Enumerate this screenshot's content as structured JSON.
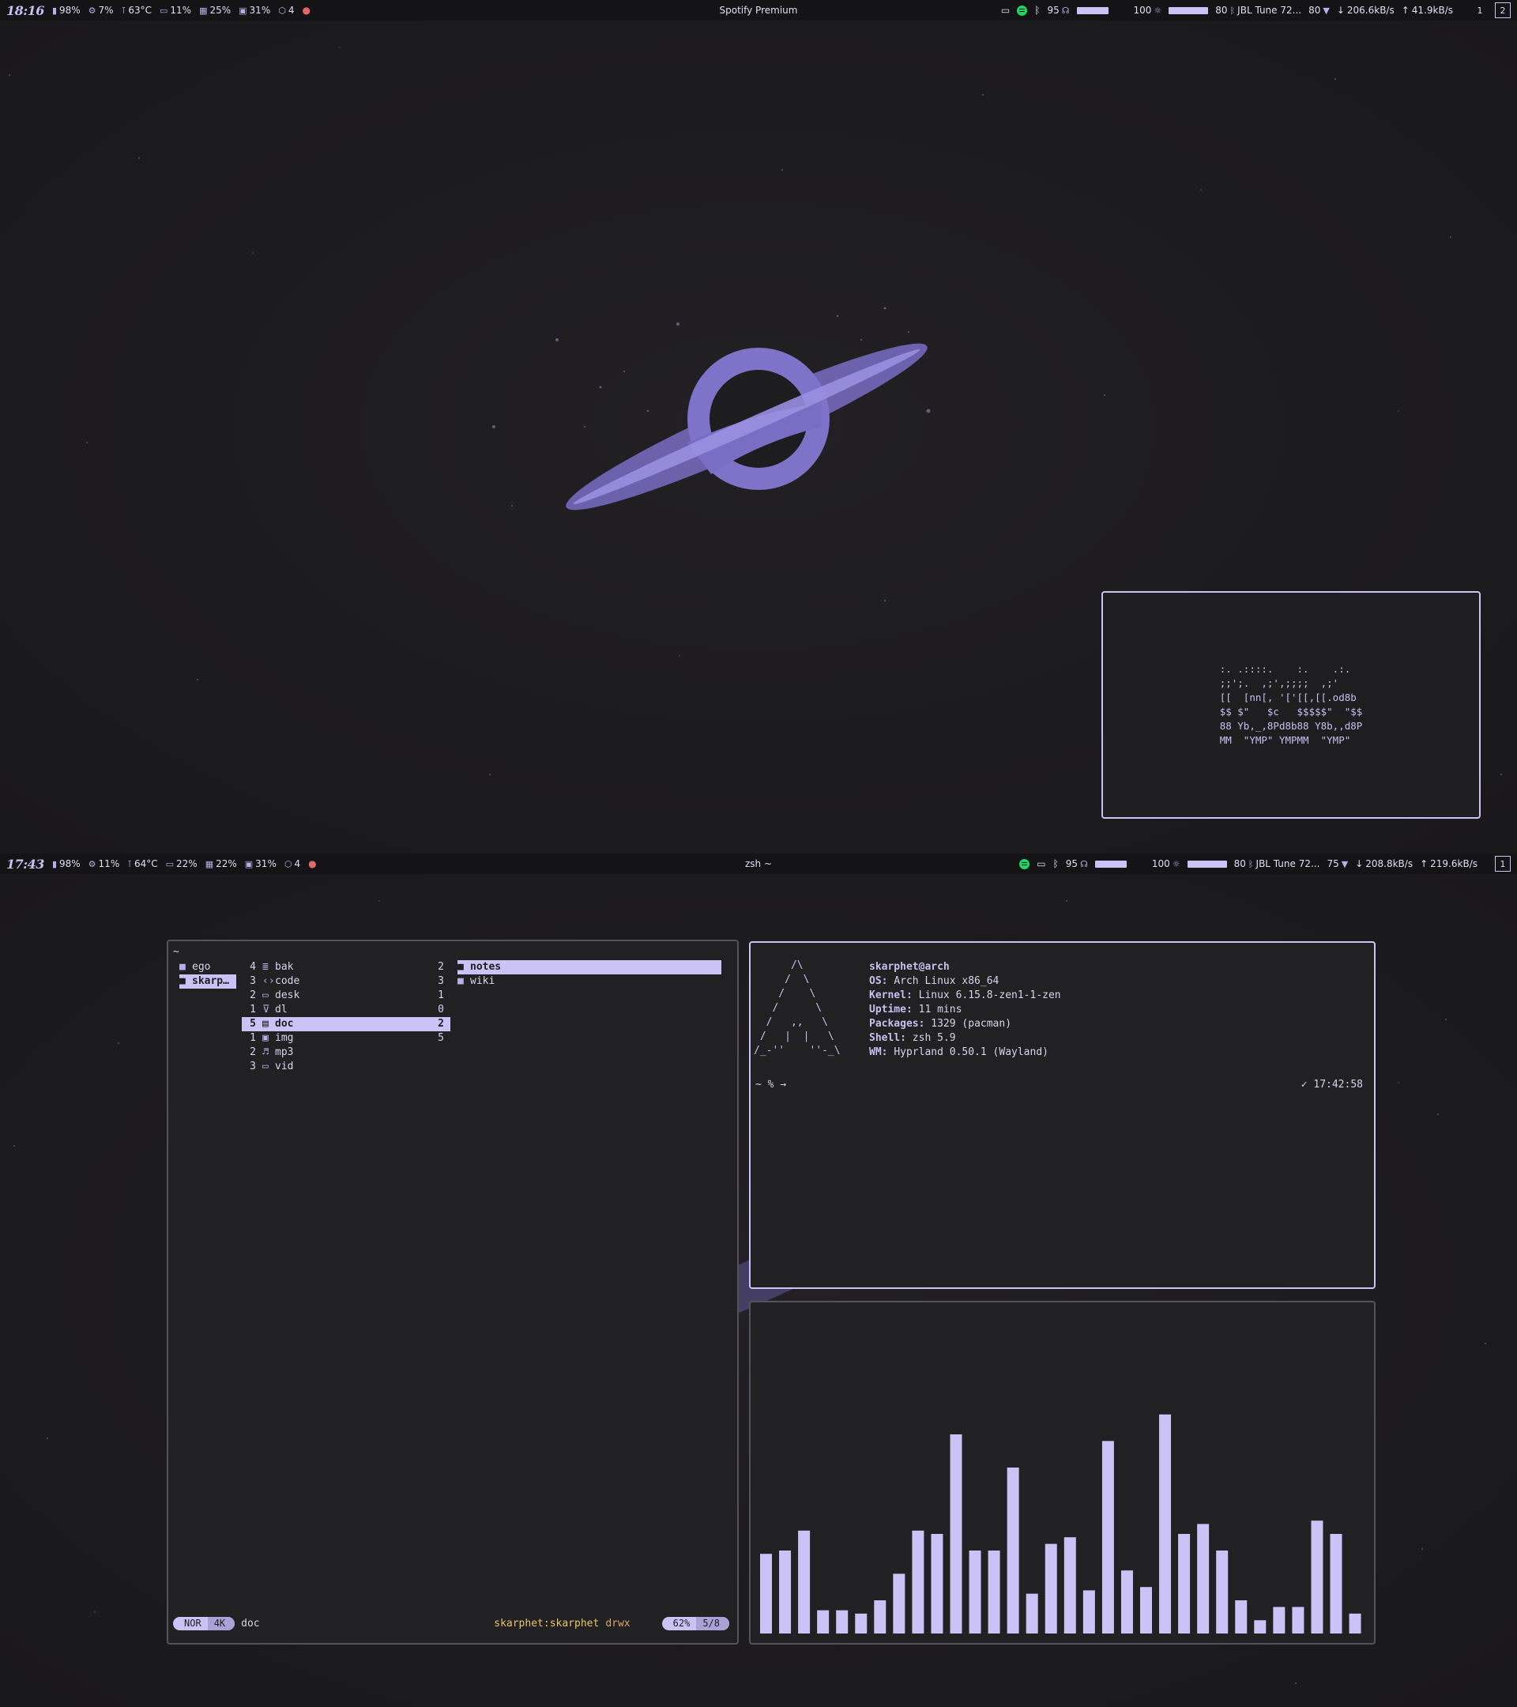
{
  "top_bar": {
    "clock": "18:16",
    "modules": [
      {
        "icon": "battery-icon",
        "glyph": "▮",
        "value": "98%"
      },
      {
        "icon": "cpu-icon",
        "glyph": "⚙",
        "value": "7%"
      },
      {
        "icon": "temperature-icon",
        "glyph": "🌡",
        "value": "63°C"
      },
      {
        "icon": "display-icon",
        "glyph": "▭",
        "value": "11%"
      },
      {
        "icon": "memory-icon",
        "glyph": "▦",
        "value": "25%"
      },
      {
        "icon": "disk-icon",
        "glyph": "▣",
        "value": "31%"
      },
      {
        "icon": "updates-icon",
        "glyph": "⬡",
        "value": "4"
      }
    ],
    "window_title": "Spotify Premium",
    "volume": "95",
    "brightness": "100",
    "bluetooth_battery": "80",
    "bluetooth_device": "JBL Tune 72...",
    "wifi_strength": "80",
    "net_down": "206.6kB/s",
    "net_up": "41.9kB/s",
    "workspaces": [
      "1",
      "2"
    ],
    "active_workspace": "2"
  },
  "fastfetch_art": ":. .::::.    :.    .:.\n;;';.  ,;',;;;;  ,;'\n[[  [nn[, '['[[,[[.od8b\n$$ $\"   $c   $$$$$\"  \"$$\n88 Yb,_,8Pd8b88 Y8b,,d8P\nMM  \"YMP\" YMPMM  \"YMP\"",
  "bottom_bar": {
    "clock": "17:43",
    "modules": [
      {
        "icon": "battery-icon",
        "glyph": "▮",
        "value": "98%"
      },
      {
        "icon": "cpu-icon",
        "glyph": "⚙",
        "value": "11%"
      },
      {
        "icon": "temperature-icon",
        "glyph": "🌡",
        "value": "64°C"
      },
      {
        "icon": "gpu-icon",
        "glyph": "▭",
        "value": "22%"
      },
      {
        "icon": "memory-icon",
        "glyph": "▦",
        "value": "22%"
      },
      {
        "icon": "disk-icon",
        "glyph": "▣",
        "value": "31%"
      },
      {
        "icon": "updates-icon",
        "glyph": "⬡",
        "value": "4"
      }
    ],
    "window_title": "zsh ~",
    "volume": "95",
    "brightness": "100",
    "bluetooth_battery": "80",
    "bluetooth_device": "JBL Tune 72...",
    "wifi_strength": "75",
    "net_down": "208.8kB/s",
    "net_up": "219.6kB/s",
    "workspaces": [
      "1"
    ],
    "active_workspace": "1"
  },
  "file_manager": {
    "path": "~",
    "parent": [
      {
        "name": "ego",
        "selected": false
      },
      {
        "name": "skarp…",
        "selected": true
      }
    ],
    "current": [
      {
        "left": "4",
        "icon": "archive-icon",
        "glyph": "≣",
        "name": "bak",
        "right": "2",
        "selected": false
      },
      {
        "left": "3",
        "icon": "code-icon",
        "glyph": "‹›",
        "name": "code",
        "right": "3",
        "selected": false
      },
      {
        "left": "2",
        "icon": "desktop-icon",
        "glyph": "▭",
        "name": "desk",
        "right": "1",
        "selected": false
      },
      {
        "left": "1",
        "icon": "download-icon",
        "glyph": "⊽",
        "name": "dl",
        "right": "0",
        "selected": false
      },
      {
        "left": "5",
        "icon": "document-icon",
        "glyph": "▤",
        "name": "doc",
        "right": "2",
        "selected": true
      },
      {
        "left": "1",
        "icon": "image-icon",
        "glyph": "▣",
        "name": "img",
        "right": "5",
        "selected": false
      },
      {
        "left": "2",
        "icon": "music-icon",
        "glyph": "♬",
        "name": "mp3",
        "right": "",
        "selected": false
      },
      {
        "left": "3",
        "icon": "video-icon",
        "glyph": "▭",
        "name": "vid",
        "right": "",
        "selected": false
      }
    ],
    "preview": [
      {
        "name": "notes",
        "selected": true
      },
      {
        "name": "wiki",
        "selected": false
      }
    ],
    "status": {
      "mode": "NOR",
      "size": "4K",
      "name": "doc",
      "owner": "skarphet:skarphet",
      "perms": "drwx",
      "percent": "62%",
      "position": "5/8"
    }
  },
  "terminal": {
    "logo": "      /\\\n     /  \\\n    /    \\\n   /      \\\n  /   ,,   \\\n /   |  |   \\\n/_-''    ''-_\\",
    "user_host": "skarphet@arch",
    "info": [
      {
        "key": "OS",
        "value": "Arch Linux x86_64"
      },
      {
        "key": "Kernel",
        "value": "Linux 6.15.8-zen1-1-zen"
      },
      {
        "key": "Uptime",
        "value": "11 mins"
      },
      {
        "key": "Packages",
        "value": "1329 (pacman)"
      },
      {
        "key": "Shell",
        "value": "zsh 5.9"
      },
      {
        "key": "WM",
        "value": "Hyprland 0.50.1 (Wayland)"
      }
    ],
    "prompt": "~ % →",
    "status_time": "✓ 17:42:58"
  },
  "visualizer": {
    "bar_color": "#cbc2f5",
    "levels": [
      0.24,
      0.25,
      0.31,
      0.07,
      0.07,
      0.06,
      0.1,
      0.18,
      0.31,
      0.3,
      0.6,
      0.25,
      0.25,
      0.5,
      0.12,
      0.27,
      0.29,
      0.13,
      0.58,
      0.19,
      0.14,
      0.66,
      0.3,
      0.33,
      0.25,
      0.1,
      0.04,
      0.08,
      0.08,
      0.34,
      0.3,
      0.06
    ]
  },
  "colors": {
    "accent": "#cbc2f5",
    "background": "#1b1a1c",
    "panel": "#212022"
  }
}
